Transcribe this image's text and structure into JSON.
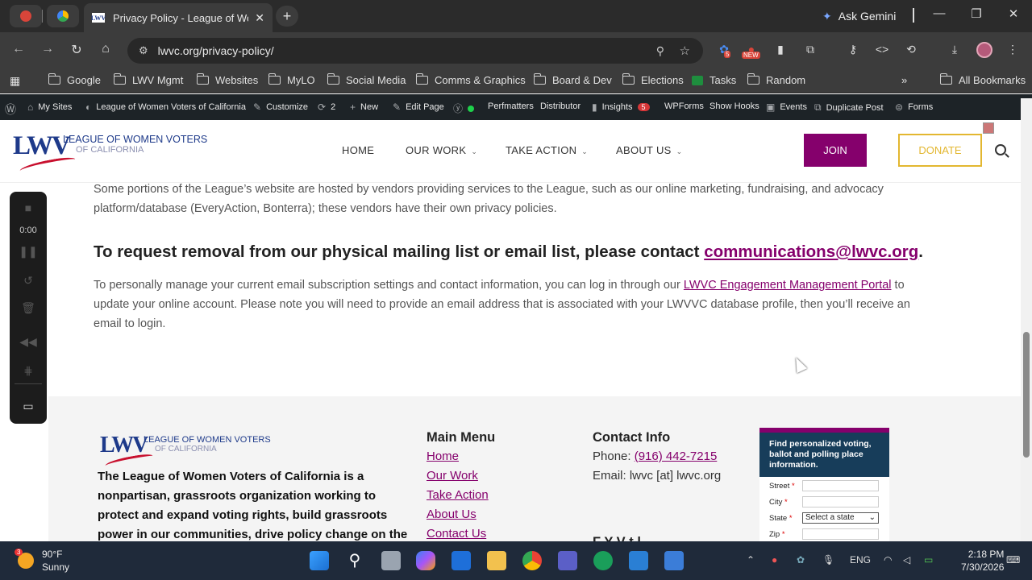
{
  "browser": {
    "active_tab_title": "Privacy Policy - League of Wom",
    "tab_favicon": "LWV",
    "ask_gemini": "Ask Gemini",
    "url": "lwvc.org/privacy-policy/",
    "ext_badge_count": "5",
    "ext_new_badge": "NEW"
  },
  "bookmarks": {
    "items": [
      "Google",
      "LWV Mgmt",
      "Websites",
      "MyLO",
      "Social Media",
      "Comms & Graphics",
      "Board & Dev",
      "Elections",
      "Tasks",
      "Random"
    ],
    "all_bookmarks": "All Bookmarks"
  },
  "wp_admin": {
    "my_sites": "My Sites",
    "site_name": "League of Women Voters of California",
    "customize": "Customize",
    "updates": "2",
    "new": "New",
    "edit_page": "Edit Page",
    "perfmatters": "Perfmatters",
    "distributor": "Distributor",
    "insights": "Insights",
    "insights_badge": "5",
    "wpforms": "WPForms",
    "show_hooks": "Show Hooks",
    "events": "Events",
    "duplicate_post": "Duplicate Post",
    "forms": "Forms"
  },
  "site": {
    "logo_mark": "LWV",
    "logo_line1": "LEAGUE OF WOMEN VOTERS",
    "logo_line2": "OF CALIFORNIA",
    "nav": {
      "home": "HOME",
      "our_work": "OUR WORK",
      "take_action": "TAKE ACTION",
      "about_us": "ABOUT US"
    },
    "join": "JOIN",
    "donate": "DONATE"
  },
  "content": {
    "p1": "Some portions of the League’s website are hosted by vendors providing services to the League, such as our online marketing, fundraising, and advocacy platform/database (EveryAction, Bonterra); these vendors have their own privacy policies.",
    "h2_text": "To request removal from our physical mailing list or email list, please contact ",
    "h2_email": "communications@lwvc.org",
    "h2_end": ".",
    "p2_start": "To personally manage your current email subscription settings and contact information, you can log in through our ",
    "p2_link": "LWVC Engagement Management Portal",
    "p2_end": " to update your online account. Please note you will need to provide an email address that is associated with your LWVVC database profile, then you’ll receive an email to login."
  },
  "recorder": {
    "time": "0:00"
  },
  "footer": {
    "about": "The League of Women Voters of California is a nonpartisan, grassroots organization working to protect and expand voting rights, build grassroots power in our communities, drive policy change on the biggest challenges facing our",
    "main_menu_title": "Main Menu",
    "menu": [
      "Home",
      "Our Work",
      "Take Action",
      "About Us",
      "Contact Us"
    ],
    "contact_title": "Contact Info",
    "phone_label": "Phone: ",
    "phone": "(916) 442-7215",
    "email": "Email: lwvc [at] lwvc.org",
    "partial_heading": "F       Y    V  t  l",
    "widget": {
      "header": "Find personalized voting, ballot and polling place information.",
      "street": "Street",
      "city": "City",
      "state": "State",
      "state_select": "Select a state",
      "zip": "Zip",
      "required": "*"
    }
  },
  "taskbar": {
    "weather_badge": "3",
    "temp": "90°F",
    "condition": "Sunny",
    "lang": "ENG",
    "time": "2:18 PM",
    "date": "7/30/2026"
  }
}
